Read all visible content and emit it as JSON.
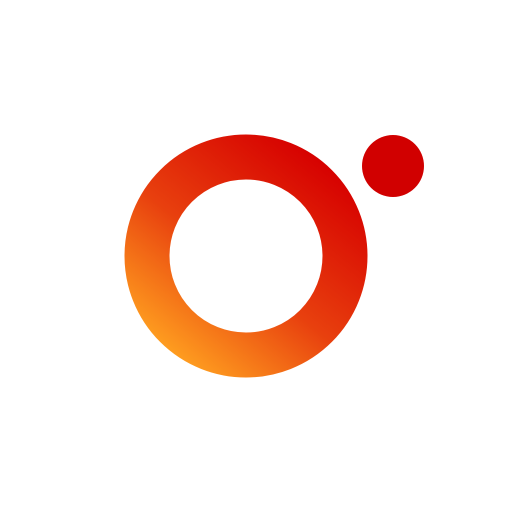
{
  "logo": {
    "name": "ring-and-dot-logo",
    "colors": {
      "background": "#ffffff",
      "ring_gradient_start": "#d60000",
      "ring_gradient_end": "#ffa020",
      "dot": "#d10000"
    }
  }
}
